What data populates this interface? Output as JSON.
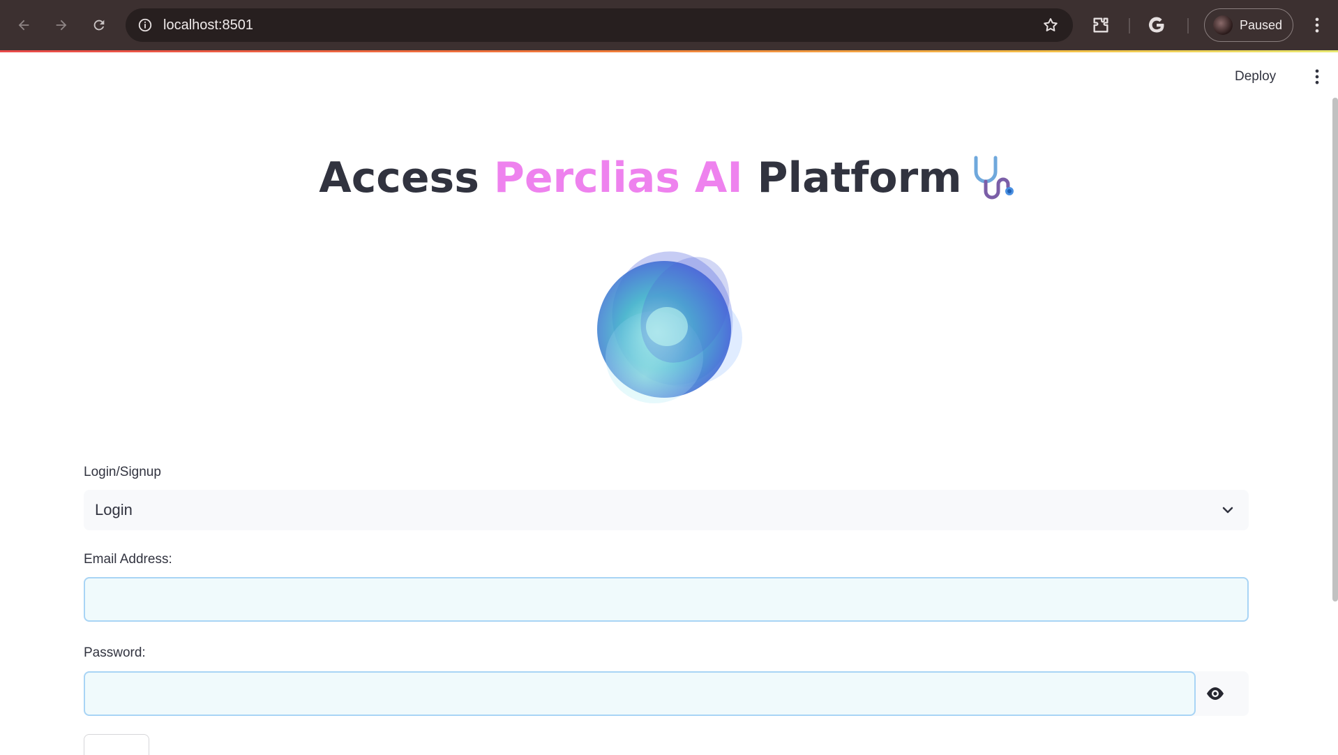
{
  "browser": {
    "url": "localhost:8501",
    "profile_status": "Paused"
  },
  "app_header": {
    "deploy_label": "Deploy"
  },
  "page": {
    "title_part1": "Access ",
    "title_accent": "Perclias AI",
    "title_part2": " Platform",
    "accent_color": "#ee82ee"
  },
  "form": {
    "mode_label": "Login/Signup",
    "mode_value": "Login",
    "email_label": "Email Address:",
    "email_value": "",
    "password_label": "Password:",
    "password_value": ""
  }
}
